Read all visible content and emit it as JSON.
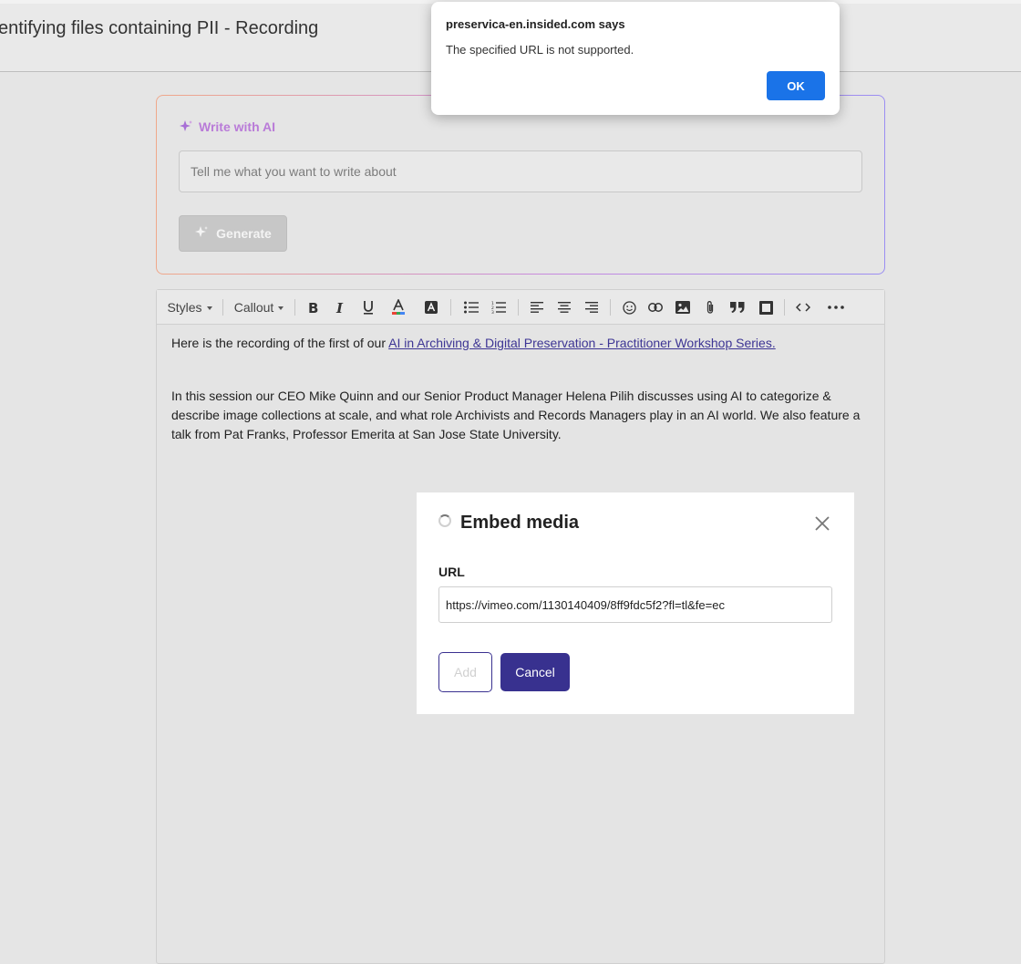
{
  "page": {
    "title": "entifying files containing PII - Recording"
  },
  "ai_panel": {
    "title": "Write with AI",
    "placeholder": "Tell me what you want to write about",
    "generate_label": "Generate",
    "accent_color": "#b97bd8"
  },
  "toolbar": {
    "styles_label": "Styles",
    "callout_label": "Callout",
    "buttons": [
      "bold-icon",
      "italic-icon",
      "underline-icon",
      "text-color-icon",
      "highlight-icon",
      "bulleted-list-icon",
      "numbered-list-icon",
      "align-left-icon",
      "align-center-icon",
      "align-right-icon",
      "emoji-icon",
      "link-icon",
      "image-icon",
      "attachment-icon",
      "quote-icon",
      "embed-icon",
      "code-icon",
      "more-icon"
    ]
  },
  "content": {
    "p1_text": "Here is the recording of the first of our ",
    "p1_link": "AI in Archiving & Digital Preservation - Practitioner Workshop Series.",
    "p2_text": "In this session our CEO Mike Quinn and our Senior Product Manager Helena Pilih discusses using AI to categorize & describe image collections at scale, and what role Archivists and Records Managers play in an AI world. We also feature a talk from Pat Franks, Professor Emerita at San Jose State University."
  },
  "embed_dialog": {
    "title": "Embed media",
    "url_label": "URL",
    "url_value": "https://vimeo.com/1130140409/8ff9fdc5f2?fl=tl&fe=ec",
    "add_label": "Add",
    "cancel_label": "Cancel",
    "primary_color": "#38318f"
  },
  "alert": {
    "title": "preservica-en.insided.com says",
    "message": "The specified URL is not supported.",
    "ok_label": "OK",
    "button_color": "#1a73e8"
  }
}
